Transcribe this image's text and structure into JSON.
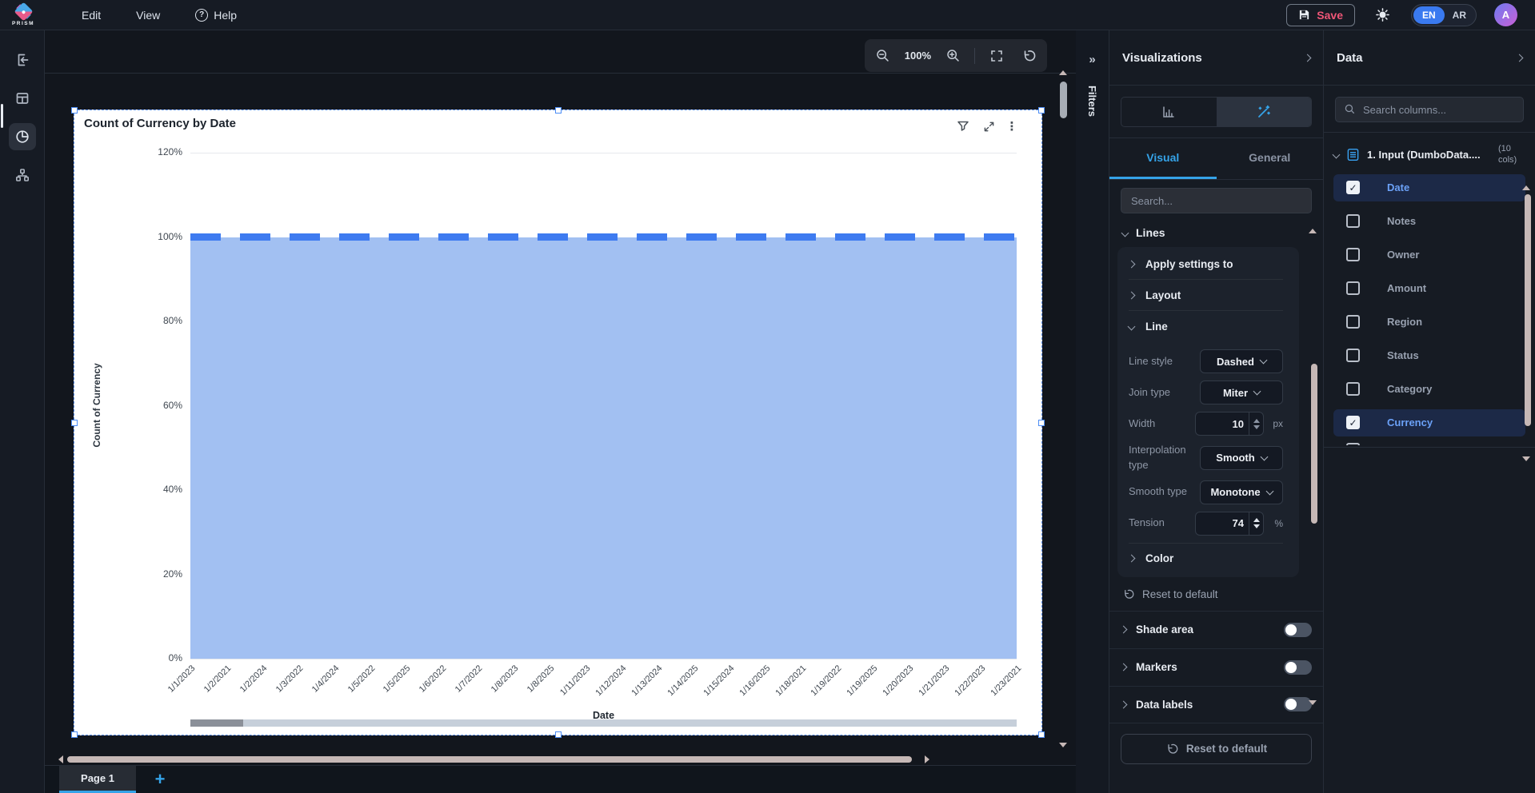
{
  "topbar": {
    "logo_text": "PRISM",
    "menus": [
      {
        "label": "Edit"
      },
      {
        "label": "View"
      },
      {
        "label": "Help"
      }
    ],
    "save_label": "Save",
    "lang_en": "EN",
    "lang_ar": "AR",
    "avatar_initial": "A"
  },
  "canvas": {
    "zoom_level": "100%",
    "filters_label": "Filters",
    "page_tab": "Page 1"
  },
  "chart_data": {
    "type": "area",
    "title": "Count of Currency by Date",
    "xlabel": "Date",
    "ylabel": "Count of Currency",
    "x": [
      "1/1/2023",
      "1/2/2021",
      "1/2/2024",
      "1/3/2022",
      "1/4/2024",
      "1/5/2022",
      "1/5/2025",
      "1/6/2022",
      "1/7/2022",
      "1/8/2023",
      "1/8/2025",
      "1/11/2023",
      "1/12/2024",
      "1/13/2024",
      "1/14/2025",
      "1/15/2024",
      "1/16/2025",
      "1/18/2021",
      "1/19/2022",
      "1/19/2025",
      "1/20/2023",
      "1/21/2023",
      "1/22/2023",
      "1/23/2021"
    ],
    "series": [
      {
        "name": "Count of Currency",
        "values": [
          100,
          100,
          100,
          100,
          100,
          100,
          100,
          100,
          100,
          100,
          100,
          100,
          100,
          100,
          100,
          100,
          100,
          100,
          100,
          100,
          100,
          100,
          100,
          100
        ]
      }
    ],
    "ylim": [
      0,
      120
    ],
    "yticks": [
      "0%",
      "20%",
      "40%",
      "60%",
      "80%",
      "100%",
      "120%"
    ],
    "grid": true,
    "line_style": "dashed",
    "line_color": "#3e7bf0",
    "fill_color": "#a2c0f2"
  },
  "visualizations": {
    "title": "Visualizations",
    "tab_visual": "Visual",
    "tab_general": "General",
    "search_placeholder": "Search...",
    "section_lines": "Lines",
    "groups": [
      {
        "label": "Apply settings to"
      },
      {
        "label": "Layout"
      }
    ],
    "line_group_label": "Line",
    "settings": [
      {
        "label": "Line style",
        "value": "Dashed",
        "type": "select"
      },
      {
        "label": "Join type",
        "value": "Miter",
        "type": "select"
      },
      {
        "label": "Width",
        "value": "10",
        "type": "number",
        "suffix": "px"
      },
      {
        "label": "Interpolation type",
        "value": "Smooth",
        "type": "select"
      },
      {
        "label": "Smooth type",
        "value": "Monotone",
        "type": "select"
      },
      {
        "label": "Tension",
        "value": "74",
        "type": "number",
        "suffix": "%"
      }
    ],
    "color_group_label": "Color",
    "reset_link": "Reset to default",
    "toggles": [
      {
        "label": "Shade area",
        "on": false
      },
      {
        "label": "Markers",
        "on": false
      },
      {
        "label": "Data labels",
        "on": false
      }
    ],
    "reset_button": "Reset to default"
  },
  "data_panel": {
    "title": "Data",
    "search_placeholder": "Search columns...",
    "source_name": "1. Input (DumboData....",
    "source_cols": "(10 cols)",
    "columns": [
      {
        "name": "Date",
        "checked": true
      },
      {
        "name": "Notes",
        "checked": false
      },
      {
        "name": "Owner",
        "checked": false
      },
      {
        "name": "Amount",
        "checked": false
      },
      {
        "name": "Region",
        "checked": false
      },
      {
        "name": "Status",
        "checked": false
      },
      {
        "name": "Category",
        "checked": false
      },
      {
        "name": "Currency",
        "checked": true
      }
    ]
  },
  "colors": {
    "accent_blue": "#3a7af0",
    "accent_cyan": "#35a3e8",
    "save_pink": "#ef5677",
    "selected_item_text": "#6ba1f7"
  }
}
